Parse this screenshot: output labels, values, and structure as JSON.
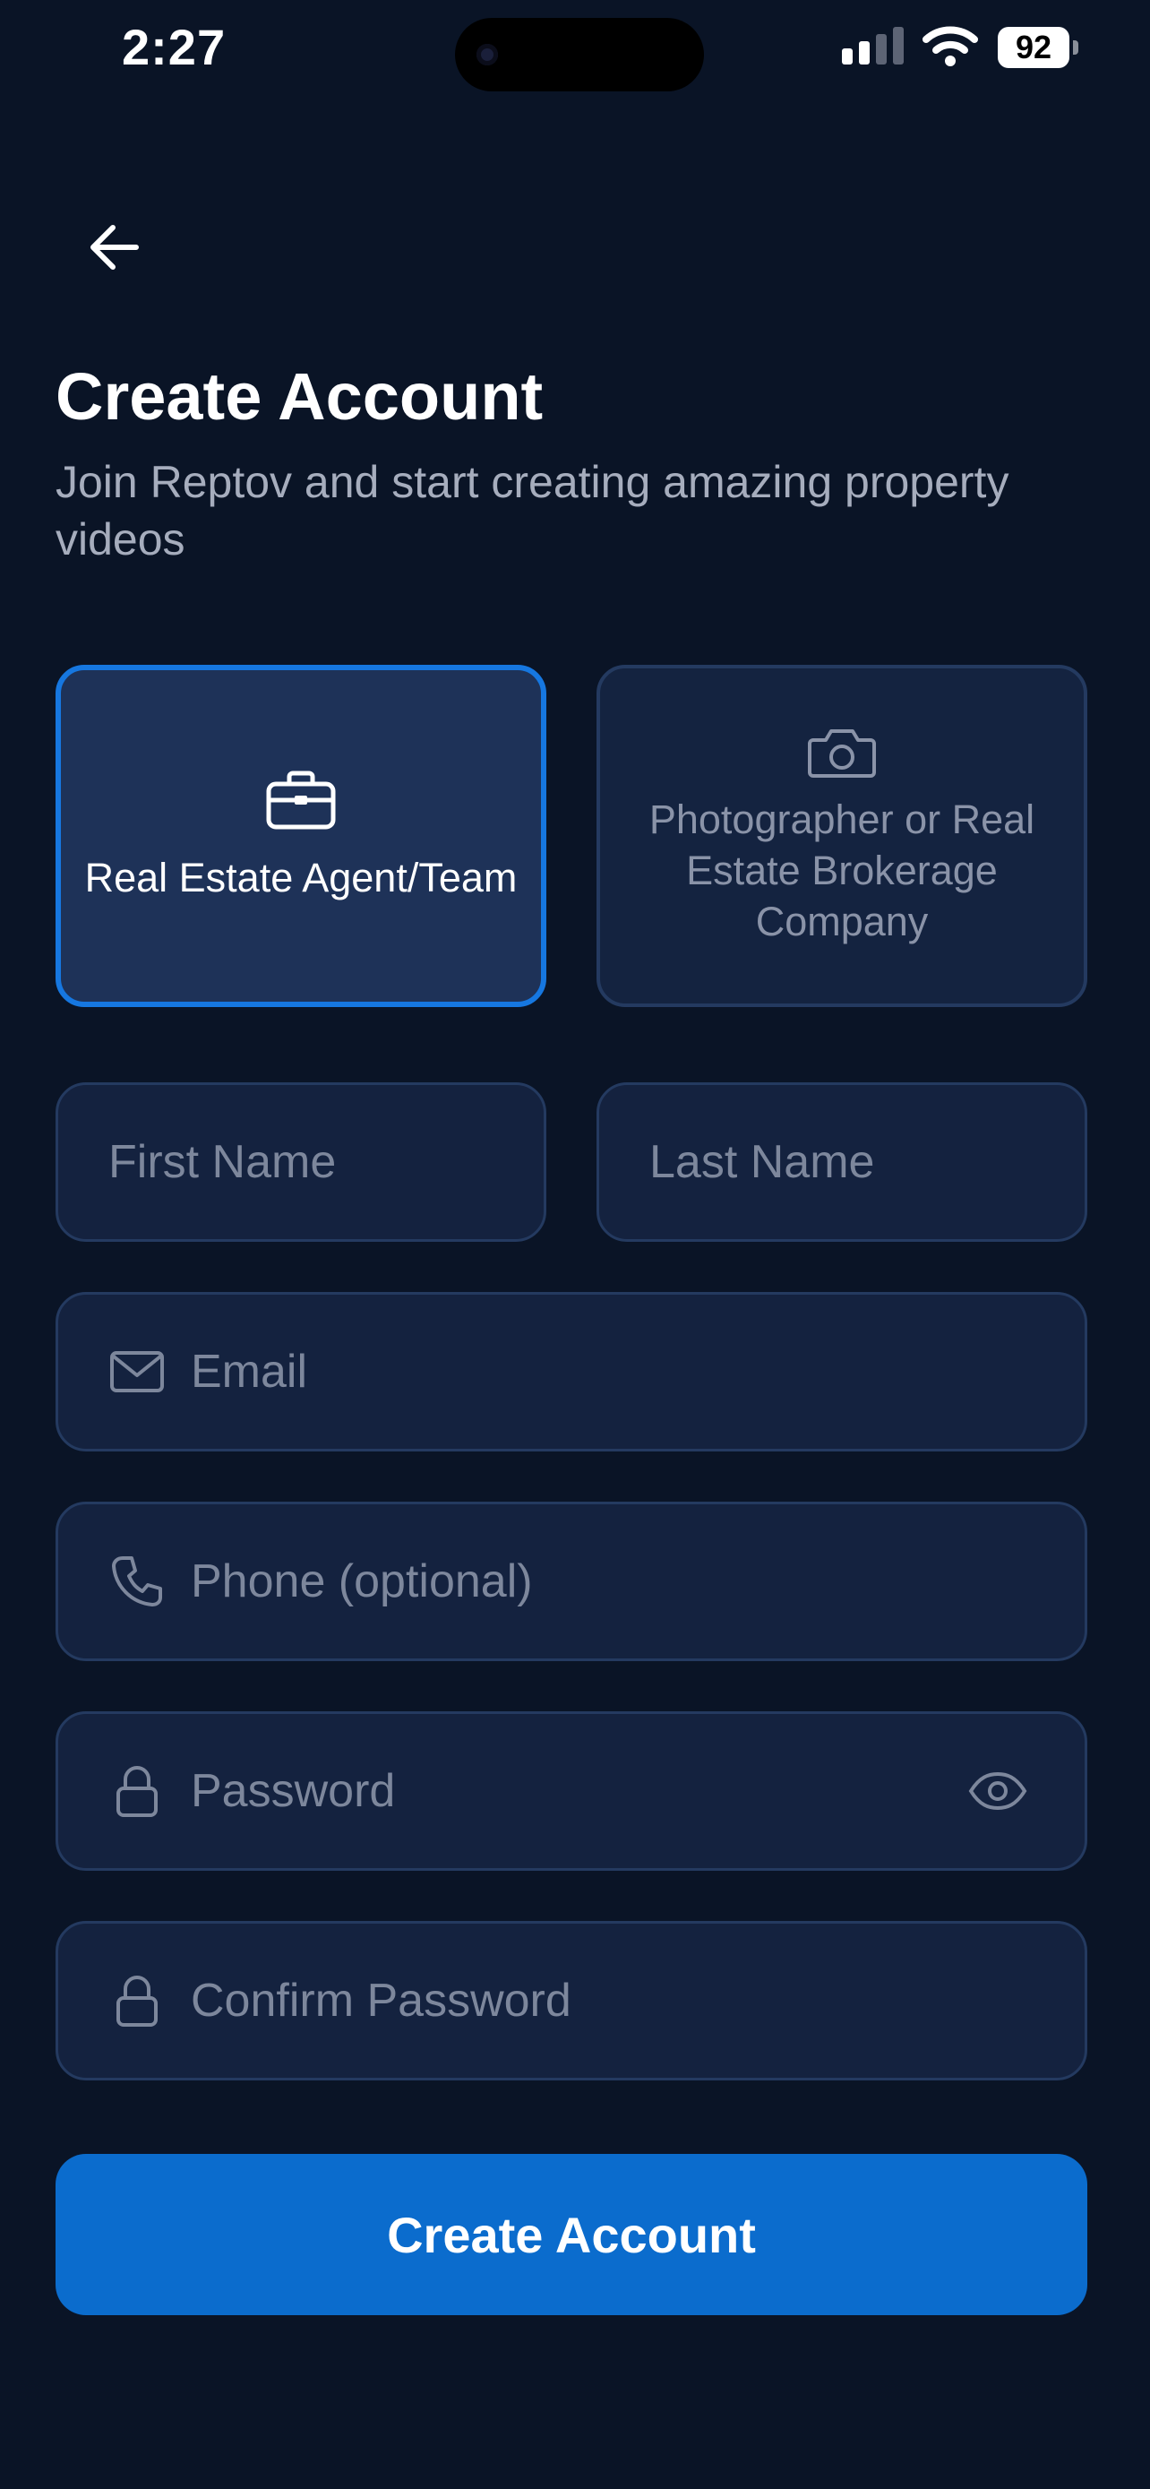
{
  "status_bar": {
    "time": "2:27",
    "battery": "92",
    "icons": [
      "signal-icon",
      "wifi-icon",
      "battery-icon"
    ]
  },
  "nav": {
    "back_icon": "arrow-left-icon"
  },
  "header": {
    "title": "Create Account",
    "subtitle": "Join Reptov and start creating amazing property videos"
  },
  "roles": {
    "selected": "agent",
    "agent": {
      "label": "Real Estate Agent/Team",
      "icon": "briefcase-icon"
    },
    "photographer": {
      "label": "Photographer or Real Estate Brokerage Company",
      "icon": "camera-icon"
    }
  },
  "form": {
    "first_name": {
      "placeholder": "First Name",
      "value": ""
    },
    "last_name": {
      "placeholder": "Last Name",
      "value": ""
    },
    "email": {
      "placeholder": "Email",
      "value": "",
      "icon": "mail-icon"
    },
    "phone": {
      "placeholder": "Phone (optional)",
      "value": "",
      "icon": "phone-icon"
    },
    "password": {
      "placeholder": "Password",
      "value": "",
      "icon": "lock-icon",
      "toggle_icon": "eye-icon"
    },
    "confirm_password": {
      "placeholder": "Confirm Password",
      "value": "",
      "icon": "lock-icon"
    },
    "submit_label": "Create Account"
  },
  "colors": {
    "background": "#0a1426",
    "field_background": "#14223f",
    "field_border": "#243a60",
    "selected_card_background": "#1e3258",
    "accent": "#1677e0",
    "button": "#0b6ccd",
    "placeholder": "#7d879c",
    "subtitle": "#a6adbd"
  }
}
